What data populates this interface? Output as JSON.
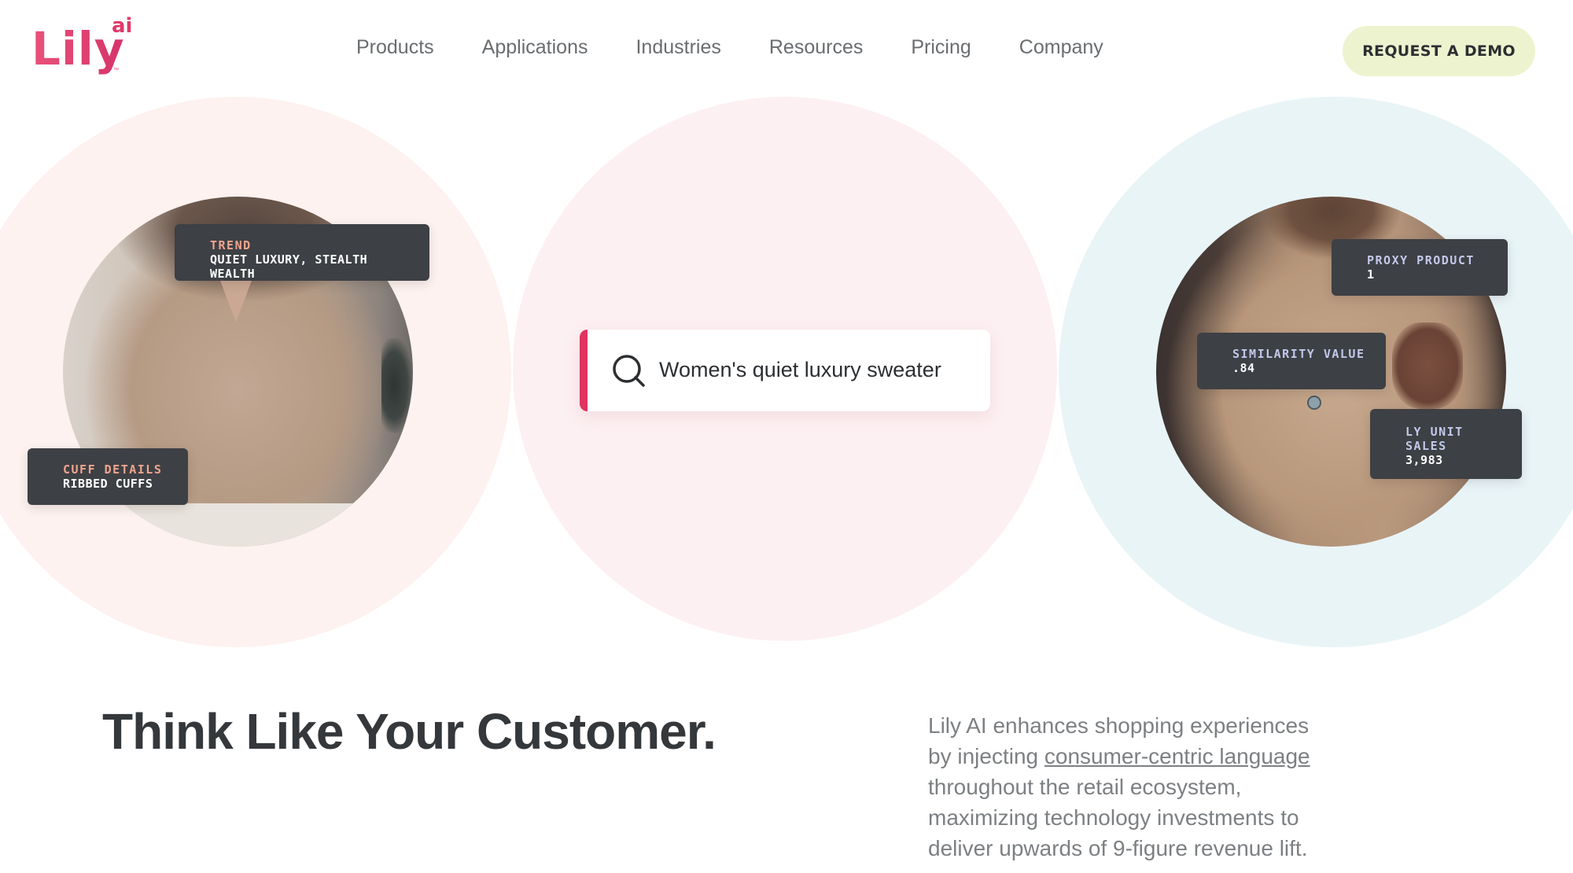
{
  "header": {
    "logo": {
      "text": "Lily",
      "superscript": "ai",
      "trademark": "™"
    },
    "nav": [
      {
        "label": "Products"
      },
      {
        "label": "Applications"
      },
      {
        "label": "Industries"
      },
      {
        "label": "Resources"
      },
      {
        "label": "Pricing"
      },
      {
        "label": "Company"
      }
    ],
    "cta_label": "REQUEST A DEMO"
  },
  "hero": {
    "left_tags": {
      "trend": {
        "key": "TREND",
        "value": "QUIET LUXURY, STEALTH WEALTH"
      },
      "cuff": {
        "key": "CUFF DETAILS",
        "value": "RIBBED CUFFS"
      }
    },
    "search": {
      "query": "Women's quiet luxury sweater",
      "icon": "search-icon"
    },
    "right_tags": {
      "proxy": {
        "key": "PROXY PRODUCT",
        "value": "1"
      },
      "similarity": {
        "key": "SIMILARITY VALUE",
        "value": ".84"
      },
      "ly_sales": {
        "key_line1": "LY UNIT",
        "key_line2": "SALES",
        "value": "3,983"
      }
    }
  },
  "content": {
    "headline": "Think Like Your Customer.",
    "body_before_link": "Lily AI enhances shopping experiences by injecting ",
    "body_link": "consumer-centric language",
    "body_after_link": " throughout the retail ecosystem, maximizing technology investments to deliver upwards of 9-figure revenue lift."
  },
  "colors": {
    "brand_pink": "#e0335f",
    "cta_background": "#eef3cf",
    "tag_background": "#3d4044",
    "tag_key_salmon": "#f2a58f",
    "tag_key_lilac": "#c3c8ea",
    "circle_left": "#fdf2ef",
    "circle_middle": "#fdf0f2",
    "circle_right": "#e9f4f7"
  }
}
